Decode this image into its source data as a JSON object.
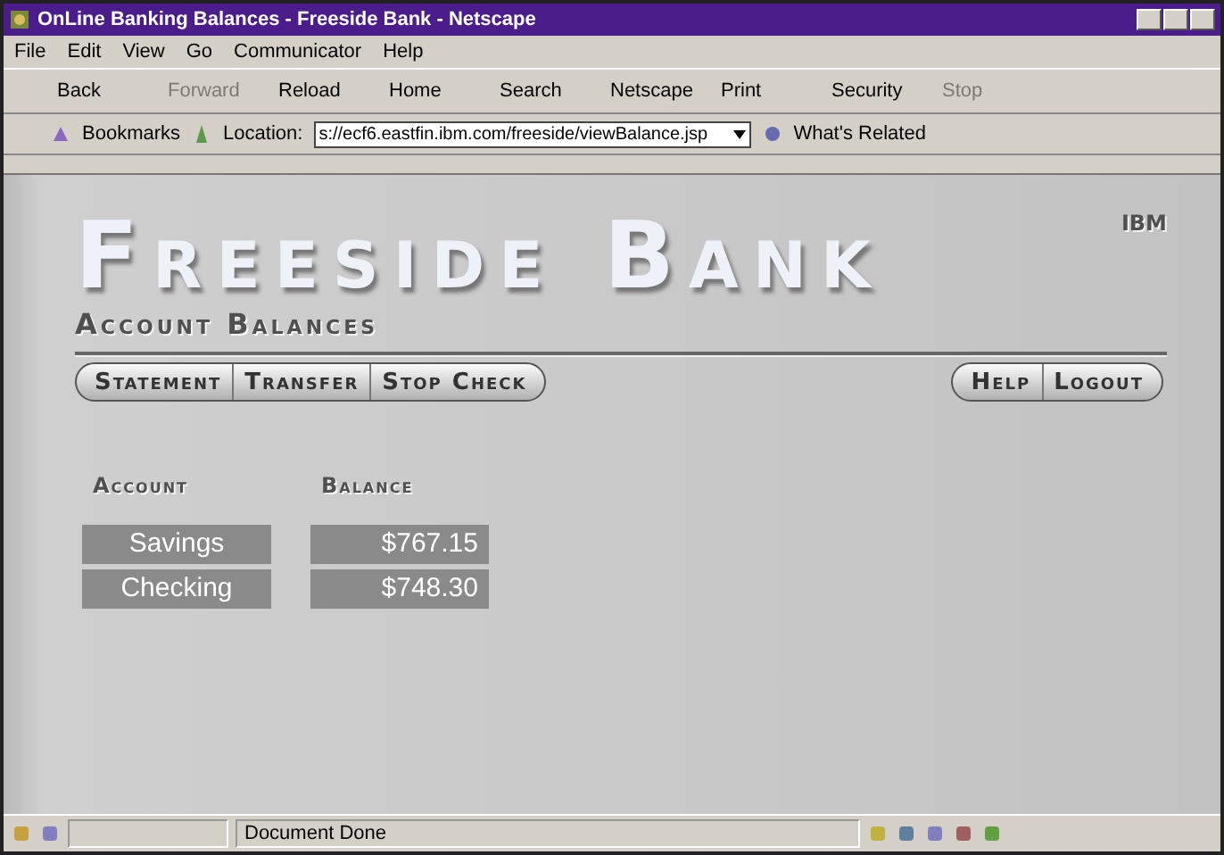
{
  "window": {
    "title": "OnLine Banking Balances - Freeside Bank - Netscape"
  },
  "menu": [
    "File",
    "Edit",
    "View",
    "Go",
    "Communicator",
    "Help"
  ],
  "toolbar": [
    {
      "label": "Back",
      "disabled": false
    },
    {
      "label": "Forward",
      "disabled": true
    },
    {
      "label": "Reload",
      "disabled": false
    },
    {
      "label": "Home",
      "disabled": false
    },
    {
      "label": "Search",
      "disabled": false
    },
    {
      "label": "Netscape",
      "disabled": false
    },
    {
      "label": "Print",
      "disabled": false
    },
    {
      "label": "Security",
      "disabled": false
    },
    {
      "label": "Stop",
      "disabled": true
    }
  ],
  "location_bar": {
    "bookmarks": "Bookmarks",
    "label": "Location:",
    "url": "s://ecf6.eastfin.ibm.com/freeside/viewBalance.jsp",
    "related": "What's Related"
  },
  "page": {
    "logo": "Freeside Bank",
    "corner_mark": "IBM",
    "subtitle": "Account Balances",
    "nav_left": [
      "Statement",
      "Transfer",
      "Stop Check"
    ],
    "nav_right": [
      "Help",
      "Logout"
    ],
    "table": {
      "columns": [
        "Account",
        "Balance"
      ],
      "rows": [
        [
          "Savings",
          "$767.15"
        ],
        [
          "Checking",
          "$748.30"
        ]
      ]
    }
  },
  "status_bar": {
    "text": "Document Done"
  }
}
